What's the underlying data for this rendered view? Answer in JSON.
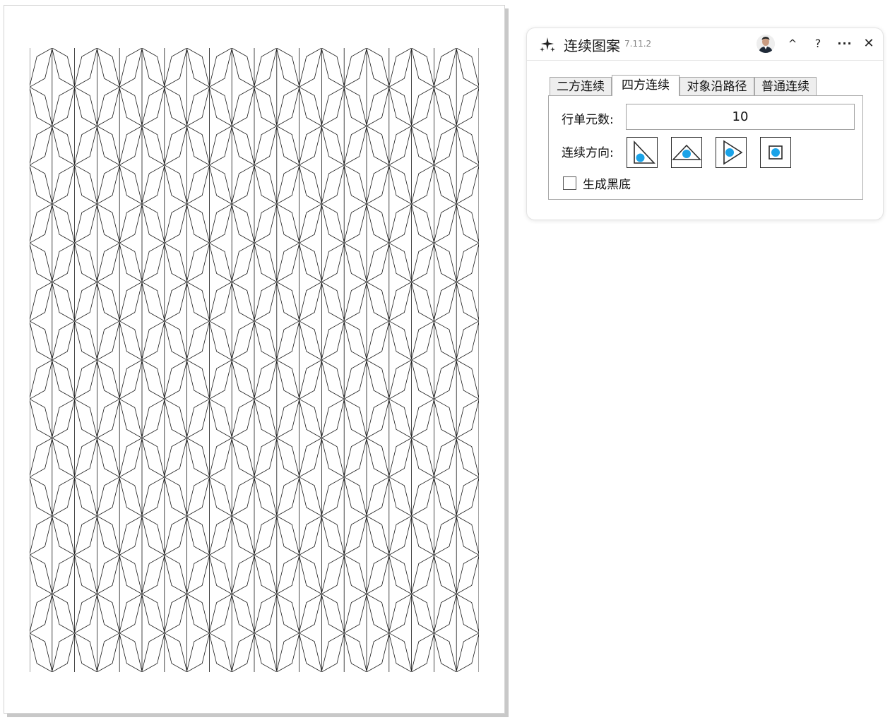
{
  "panel": {
    "title": "连续图案",
    "version": "7.11.2",
    "buttons": {
      "collapse": "^",
      "help": "?",
      "more": "···",
      "close": "✕"
    }
  },
  "tabs": [
    {
      "label": "二方连续",
      "active": false
    },
    {
      "label": "四方连续",
      "active": true
    },
    {
      "label": "对象沿路径",
      "active": false
    },
    {
      "label": "普通连续",
      "active": false
    }
  ],
  "form": {
    "rows_label": "行单元数:",
    "rows_value": "10",
    "direction_label": "连续方向:",
    "direction_icons": [
      "corner-triangle-icon",
      "up-triangle-icon",
      "right-triangle-icon",
      "square-icon"
    ],
    "black_bg_label": "生成黑底",
    "black_bg_checked": false
  },
  "colors": {
    "accent_dot": "#1aa3e8",
    "stroke": "#2a2a2a",
    "pattern_line": "#1a1a1a"
  },
  "pattern": {
    "columns": 10
  }
}
